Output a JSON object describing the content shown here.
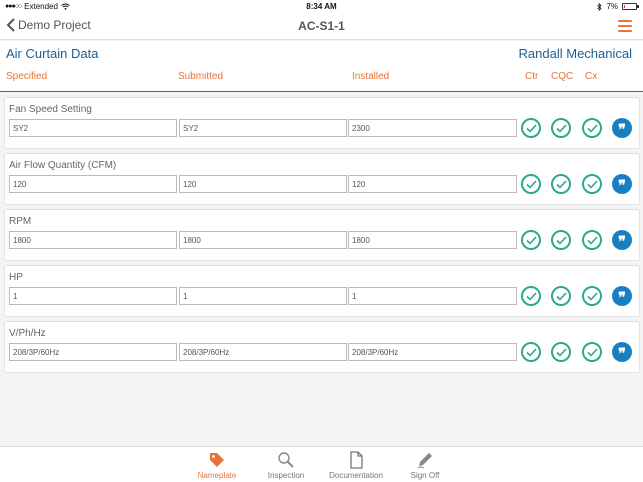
{
  "status": {
    "carrier": "Extended",
    "time": "8:34 AM",
    "battery": "7%",
    "battery_level": 0.07
  },
  "nav": {
    "back_label": "Demo Project",
    "title": "AC-S1-1"
  },
  "header": {
    "section": "Air Curtain Data",
    "company": "Randall Mechanical",
    "col_specified": "Specified",
    "col_submitted": "Submitted",
    "col_installed": "Installed",
    "col_ctr": "Ctr",
    "col_cqc": "CQC",
    "col_cx": "Cx"
  },
  "rows": [
    {
      "label": "Fan Speed Setting",
      "specified": "SY2",
      "submitted": "SY2",
      "installed": "2300"
    },
    {
      "label": "Air Flow Quantity (CFM)",
      "specified": "120",
      "submitted": "120",
      "installed": "120"
    },
    {
      "label": "RPM",
      "specified": "1800",
      "submitted": "1800",
      "installed": "1800"
    },
    {
      "label": "HP",
      "specified": "1",
      "submitted": "1",
      "installed": "1"
    },
    {
      "label": "V/Ph/Hz",
      "specified": "208/3P/60Hz",
      "submitted": "208/3P/60Hz",
      "installed": "208/3P/60Hz"
    }
  ],
  "comment_glyph": "❞",
  "tabs": [
    {
      "label": "Nameplate",
      "icon": "tag-icon",
      "active": true
    },
    {
      "label": "Inspection",
      "icon": "magnifier-icon",
      "active": false
    },
    {
      "label": "Documentation",
      "icon": "document-icon",
      "active": false
    },
    {
      "label": "Sign Off",
      "icon": "pen-icon",
      "active": false
    }
  ],
  "colors": {
    "accent": "#e8733a",
    "brand": "#1c5f93",
    "check": "#2ba98c",
    "comment": "#1a7fc2"
  }
}
